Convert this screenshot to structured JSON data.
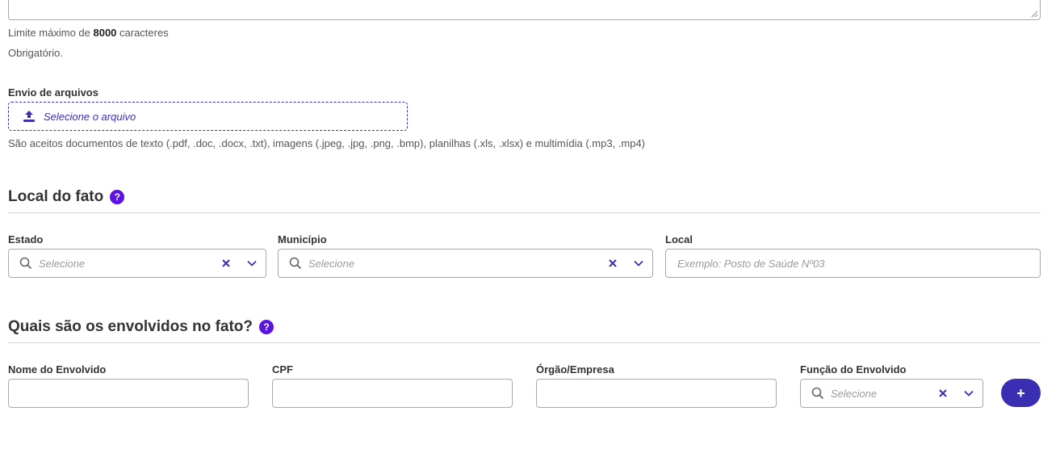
{
  "description_field": {
    "limit_prefix": "Limite máximo de ",
    "limit_value": "8000",
    "limit_suffix": " caracteres",
    "required_text": "Obrigatório."
  },
  "upload": {
    "label": "Envio de arquivos",
    "button_label": "Selecione o arquivo",
    "help_text": "São aceitos documentos de texto (.pdf, .doc, .docx, .txt), imagens (.jpeg, .jpg, .png, .bmp), planilhas (.xls, .xlsx) e multimídia (.mp3, .mp4)",
    "icon": "upload-icon"
  },
  "local_section": {
    "title": "Local do fato",
    "help": "?",
    "estado": {
      "label": "Estado",
      "placeholder": "Selecione"
    },
    "municipio": {
      "label": "Município",
      "placeholder": "Selecione"
    },
    "local": {
      "label": "Local",
      "placeholder": "Exemplo: Posto de Saúde Nº03"
    }
  },
  "envolvidos_section": {
    "title": "Quais são os envolvidos no fato?",
    "help": "?",
    "nome": {
      "label": "Nome do Envolvido"
    },
    "cpf": {
      "label": "CPF"
    },
    "orgao": {
      "label": "Órgão/Empresa"
    },
    "funcao": {
      "label": "Função do Envolvido",
      "placeholder": "Selecione"
    },
    "add_button_label": "+"
  },
  "colors": {
    "primary": "#3a2fb3",
    "help_badge": "#5b13e0",
    "border": "#a8a8a8",
    "divider": "#d4d4d4"
  }
}
